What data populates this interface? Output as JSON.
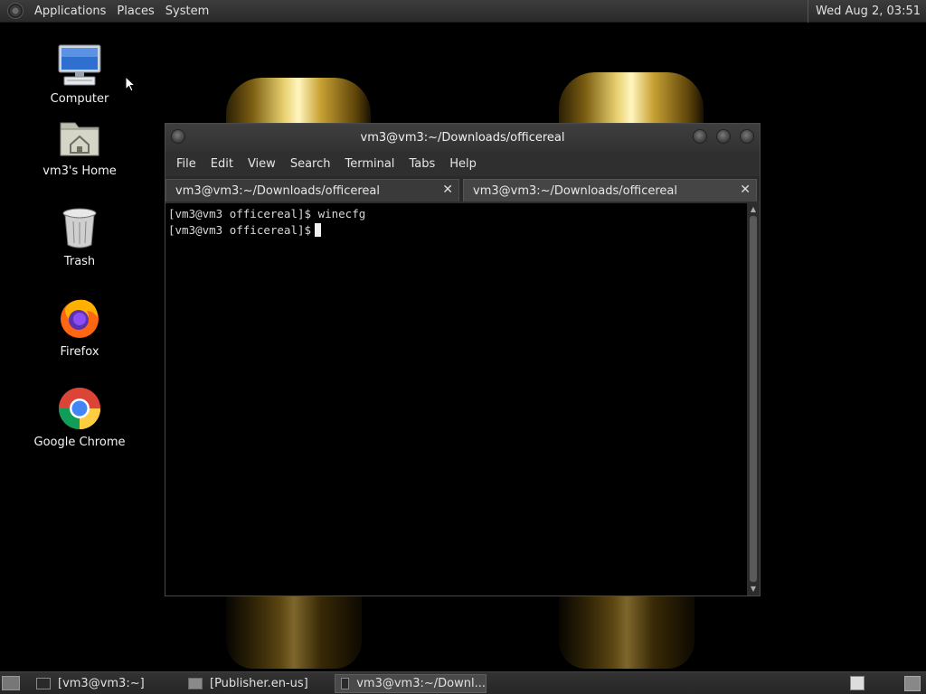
{
  "top_panel": {
    "menus": [
      "Applications",
      "Places",
      "System"
    ],
    "clock": "Wed Aug  2, 03:51"
  },
  "desktop": {
    "icons": [
      {
        "label": "Computer",
        "icon": "computer-icon"
      },
      {
        "label": "vm3's Home",
        "icon": "home-folder-icon"
      },
      {
        "label": "Trash",
        "icon": "trash-icon"
      },
      {
        "label": "Firefox",
        "icon": "firefox-icon"
      },
      {
        "label": "Google Chrome",
        "icon": "chrome-icon"
      }
    ]
  },
  "terminal": {
    "title": "vm3@vm3:~/Downloads/officereal",
    "menu": [
      "File",
      "Edit",
      "View",
      "Search",
      "Terminal",
      "Tabs",
      "Help"
    ],
    "tabs": [
      {
        "label": "vm3@vm3:~/Downloads/officereal",
        "active": false
      },
      {
        "label": "vm3@vm3:~/Downloads/officereal",
        "active": true
      }
    ],
    "lines": [
      "[vm3@vm3 officereal]$ winecfg",
      "[vm3@vm3 officereal]$"
    ],
    "close_glyph": "✕"
  },
  "bottom_panel": {
    "tasks": [
      {
        "label": "[vm3@vm3:~]",
        "icon": "terminal-icon",
        "active": false
      },
      {
        "label": "[Publisher.en-us]",
        "icon": "folder-icon",
        "active": false
      },
      {
        "label": "vm3@vm3:~/Downl...",
        "icon": "terminal-icon",
        "active": true
      }
    ]
  },
  "colors": {
    "panel_bg": "#2e2e2e",
    "terminal_bg": "#000000",
    "wallpaper_gold": "#e8d070"
  }
}
